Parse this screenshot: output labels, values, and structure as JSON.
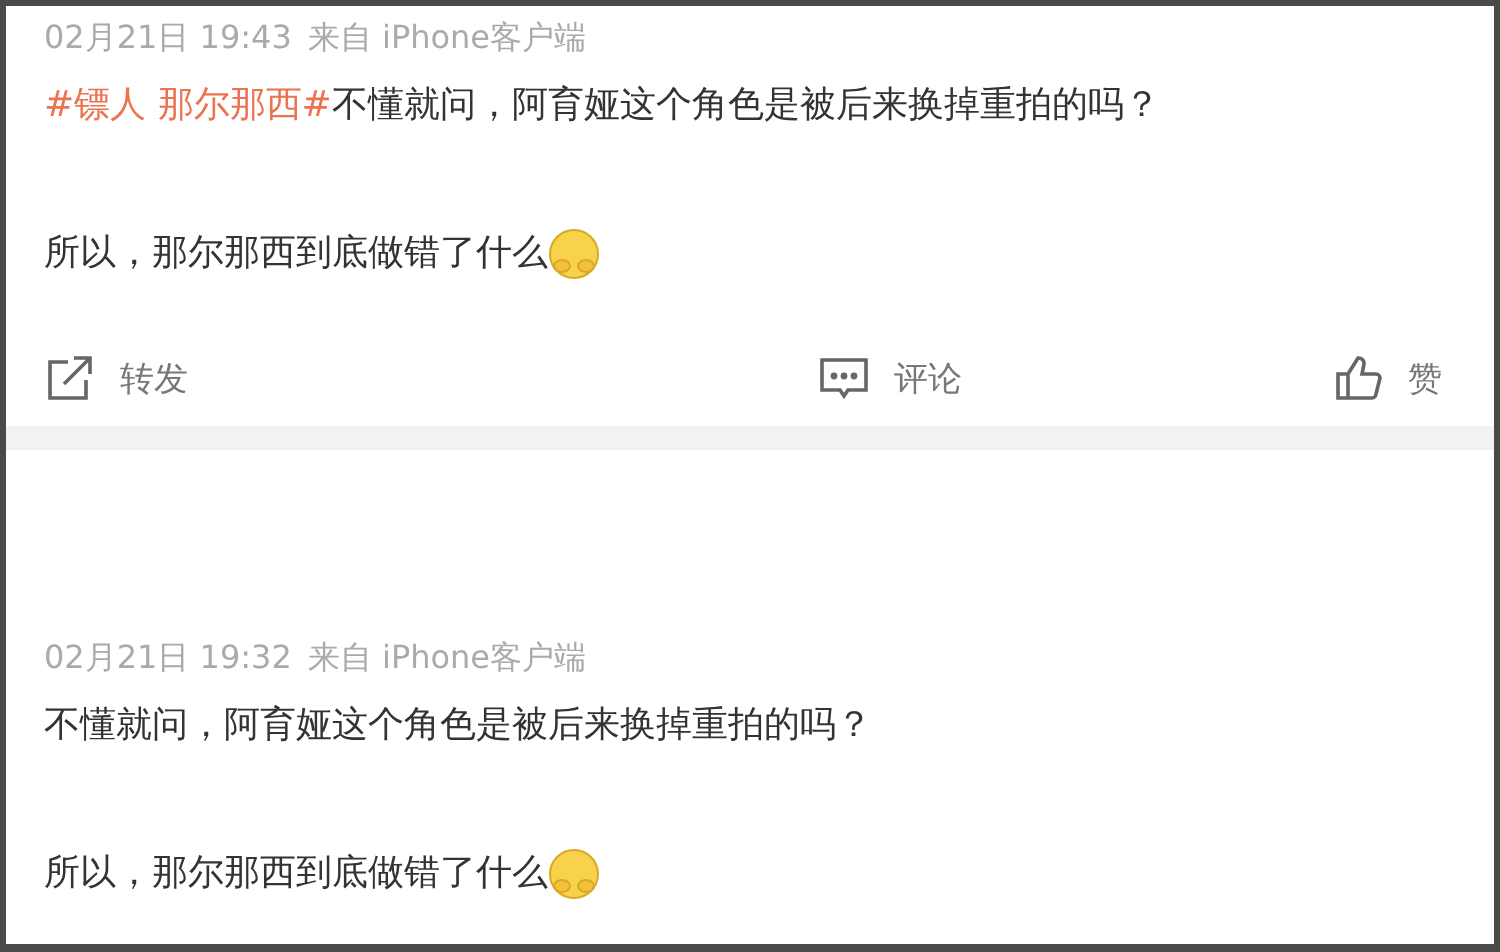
{
  "posts": [
    {
      "time": "02月21日 19:43",
      "source": "来自 iPhone客户端",
      "paragraphs": [
        [
          {
            "kind": "topic",
            "text": "#镖人 那尔那西#"
          },
          {
            "kind": "text",
            "text": "不懂就问，阿育娅这个角色是被后来换掉重拍的吗？"
          }
        ],
        [
          {
            "kind": "text",
            "text": "所以，那尔那西到底做错了什么"
          },
          {
            "kind": "emoji"
          }
        ]
      ],
      "actions": [
        {
          "kind": "share",
          "label": "转发"
        },
        {
          "kind": "comment",
          "label": "评论"
        },
        {
          "kind": "like",
          "label": "赞"
        }
      ]
    },
    {
      "time": "02月21日 19:32",
      "source": "来自 iPhone客户端",
      "paragraphs": [
        [
          {
            "kind": "text",
            "text": "不懂就问，阿育娅这个角色是被后来换掉重拍的吗？"
          }
        ],
        [
          {
            "kind": "text",
            "text": "所以，那尔那西到底做错了什么"
          },
          {
            "kind": "emoji"
          }
        ]
      ]
    }
  ]
}
